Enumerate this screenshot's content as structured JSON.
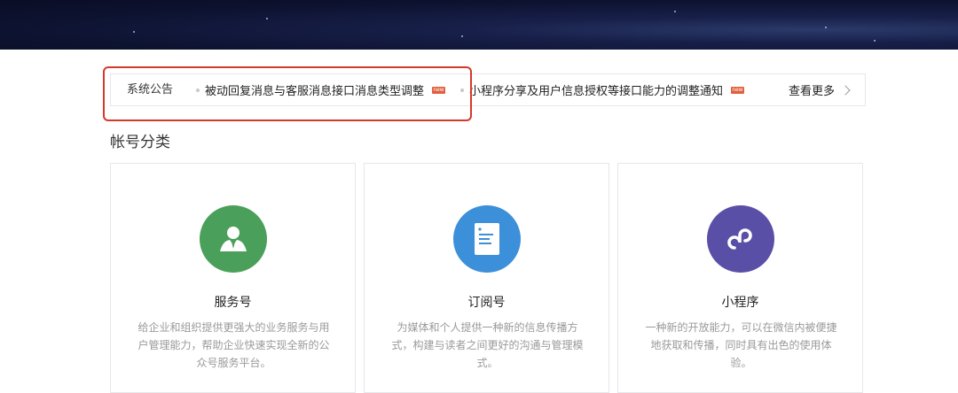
{
  "notice": {
    "label": "系统公告",
    "items": [
      {
        "text": "被动回复消息与客服消息接口消息类型调整",
        "badge": "new"
      },
      {
        "text": "小程序分享及用户信息授权等接口能力的调整通知",
        "badge": "new"
      }
    ],
    "more": "查看更多"
  },
  "section": {
    "title": "帐号分类"
  },
  "cards": [
    {
      "title": "服务号",
      "desc": "给企业和组织提供更强大的业务服务与用户管理能力，帮助企业快速实现全新的公众号服务平台。",
      "icon": "person-tie-icon",
      "color": "#4aa05a"
    },
    {
      "title": "订阅号",
      "desc": "为媒体和个人提供一种新的信息传播方式，构建与读者之间更好的沟通与管理模式。",
      "icon": "document-icon",
      "color": "#3c8fd9"
    },
    {
      "title": "小程序",
      "desc": "一种新的开放能力，可以在微信内被便捷地获取和传播，同时具有出色的使用体验。",
      "icon": "miniprogram-icon",
      "color": "#5a4fa6"
    }
  ],
  "colors": {
    "highlight": "#d6382b",
    "badge": "#e15f3d"
  }
}
